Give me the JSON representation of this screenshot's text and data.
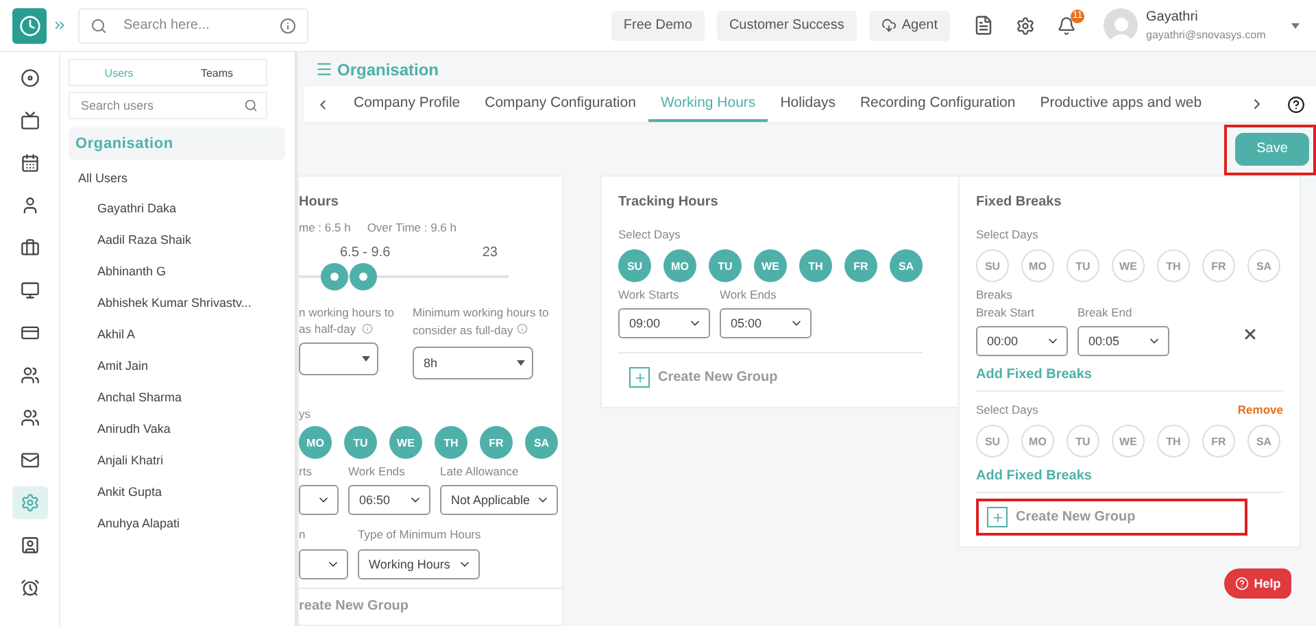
{
  "topbar": {
    "search_placeholder": "Search here...",
    "buttons": [
      {
        "label": "Free Demo",
        "kind": "plain"
      },
      {
        "label": "Customer Success",
        "kind": "plain"
      },
      {
        "label": "Agent",
        "kind": "cloud"
      }
    ],
    "notification_count": "11",
    "user": {
      "name": "Gayathri",
      "email": "gayathri@snovasys.com"
    }
  },
  "rail": [
    {
      "selected": false
    },
    {
      "selected": false
    },
    {
      "selected": false
    },
    {
      "selected": false
    },
    {
      "selected": false
    },
    {
      "selected": false
    },
    {
      "selected": false
    },
    {
      "selected": false
    },
    {
      "selected": false
    },
    {
      "selected": false
    },
    {
      "selected": true
    },
    {
      "selected": false
    },
    {
      "selected": false
    }
  ],
  "user_panel": {
    "tabs": [
      {
        "label": "Users",
        "selected": true
      },
      {
        "label": "Teams",
        "selected": false
      }
    ],
    "search_placeholder": "Search users",
    "group": {
      "label": "Organisation",
      "selected": true
    },
    "all_label": "All Users",
    "users": [
      "Gayathri Daka",
      "Aadil Raza Shaik",
      "Abhinanth G",
      "Abhishek Kumar Shrivastv...",
      "Akhil A",
      "Amit Jain",
      "Anchal Sharma",
      "Anirudh Vaka",
      "Anjali Khatri",
      "Ankit Gupta",
      "Anuhya Alapati"
    ]
  },
  "page": {
    "title": "Organisation",
    "tabs": [
      {
        "label": "Company Profile",
        "selected": false
      },
      {
        "label": "Company Configuration",
        "selected": false
      },
      {
        "label": "Working Hours",
        "selected": true
      },
      {
        "label": "Holidays",
        "selected": false
      },
      {
        "label": "Recording Configuration",
        "selected": false
      },
      {
        "label": "Productive apps and web",
        "selected": false
      }
    ],
    "save": {
      "label": "Save",
      "highlighted": true
    }
  },
  "working_card": {
    "title": "Hours",
    "summary": [
      "me : 6.5 h",
      "Over Time : 9.6 h"
    ],
    "slider": {
      "range_label": "6.5 - 9.6",
      "max_label": "23",
      "thumbs": [
        {
          "level": 0.17
        },
        {
          "level": 0.31
        }
      ]
    },
    "half_day": {
      "label": "n working hours to",
      "label_2": "as half-day"
    },
    "full_day": {
      "label": "Minimum working hours to consider as full-day",
      "value": "8h"
    },
    "days_label": "ys",
    "days": [
      {
        "label": "MO",
        "selected": true
      },
      {
        "label": "TU",
        "selected": true
      },
      {
        "label": "WE",
        "selected": true
      },
      {
        "label": "TH",
        "selected": true
      },
      {
        "label": "FR",
        "selected": true
      },
      {
        "label": "SA",
        "selected": true
      }
    ],
    "fields": [
      {
        "label": "rts"
      },
      {
        "label": "Work Ends",
        "value": "06:50"
      },
      {
        "label": "Late Allowance",
        "value": "Not Applicable"
      }
    ],
    "fields_2": [
      {
        "label": "n"
      },
      {
        "label": "Type of Minimum Hours",
        "value": "Working Hours"
      }
    ],
    "create": "reate New Group"
  },
  "tracking_card": {
    "title": "Tracking Hours",
    "days_label": "Select Days",
    "days": [
      {
        "label": "SU",
        "selected": true
      },
      {
        "label": "MO",
        "selected": true
      },
      {
        "label": "TU",
        "selected": true
      },
      {
        "label": "WE",
        "selected": true
      },
      {
        "label": "TH",
        "selected": true
      },
      {
        "label": "FR",
        "selected": true
      },
      {
        "label": "SA",
        "selected": true
      }
    ],
    "fields": [
      {
        "label": "Work Starts",
        "value": "09:00"
      },
      {
        "label": "Work Ends",
        "value": "05:00"
      }
    ],
    "create": {
      "label": "Create New Group",
      "highlighted": false
    }
  },
  "breaks_card": {
    "title": "Fixed Breaks",
    "groups": [
      {
        "days_label": "Select Days",
        "days": [
          {
            "label": "SU",
            "selected": false
          },
          {
            "label": "MO",
            "selected": false
          },
          {
            "label": "TU",
            "selected": false
          },
          {
            "label": "WE",
            "selected": false
          },
          {
            "label": "TH",
            "selected": false
          },
          {
            "label": "FR",
            "selected": false
          },
          {
            "label": "SA",
            "selected": false
          }
        ],
        "breaks_label": "Breaks",
        "breaks": [
          {
            "fields": [
              {
                "label": "Break Start",
                "value": "00:00"
              },
              {
                "label": "Break End",
                "value": "00:05"
              }
            ]
          }
        ],
        "add": "Add Fixed Breaks"
      },
      {
        "days_label": "Select Days",
        "remove": "Remove",
        "days": [
          {
            "label": "SU",
            "selected": false
          },
          {
            "label": "MO",
            "selected": false
          },
          {
            "label": "TU",
            "selected": false
          },
          {
            "label": "WE",
            "selected": false
          },
          {
            "label": "TH",
            "selected": false
          },
          {
            "label": "FR",
            "selected": false
          },
          {
            "label": "SA",
            "selected": false
          }
        ],
        "add": "Add Fixed Breaks"
      }
    ],
    "create": {
      "label": "Create New Group",
      "highlighted": true
    }
  },
  "help": "Help"
}
